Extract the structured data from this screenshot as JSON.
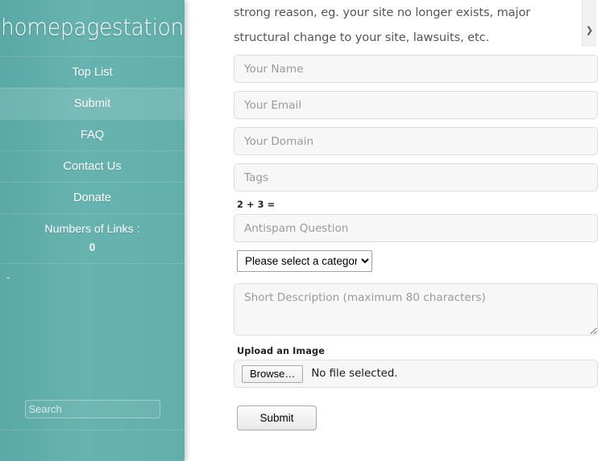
{
  "sidebar": {
    "logo": "homepagestation",
    "nav_items": [
      {
        "label": "Top List",
        "active": false
      },
      {
        "label": "Submit",
        "active": true
      },
      {
        "label": "FAQ",
        "active": false
      },
      {
        "label": "Contact Us",
        "active": false
      },
      {
        "label": "Donate",
        "active": false
      }
    ],
    "links_counter": {
      "label": "Numbers of Links :",
      "value": "0"
    },
    "dash": "-",
    "search": {
      "placeholder": "Search",
      "value": ""
    },
    "colors": {
      "background": "#63afac",
      "active_item": "#6db8b4",
      "text": "#ffffff"
    }
  },
  "main": {
    "intro_text": "strong reason, eg. your site no longer exists, major structural change to your site, lawsuits, etc.",
    "scrollbar": {
      "down_arrow_icon": "chevron-down-icon"
    },
    "form": {
      "name": {
        "placeholder": "Your Name",
        "value": ""
      },
      "email": {
        "placeholder": "Your Email",
        "value": ""
      },
      "domain": {
        "placeholder": "Your Domain",
        "value": ""
      },
      "tags": {
        "placeholder": "Tags",
        "value": ""
      },
      "antispam": {
        "question_label": "2 + 3 =",
        "placeholder": "Antispam Question",
        "value": ""
      },
      "category": {
        "selected": "Please select a category..",
        "options": [
          "Please select a category.."
        ]
      },
      "description": {
        "placeholder": "Short Description (maximum 80 characters)",
        "value": ""
      },
      "upload": {
        "label": "Upload an Image",
        "browse_label": "Browse…",
        "status": "No file selected."
      },
      "submit_label": "Submit"
    }
  }
}
